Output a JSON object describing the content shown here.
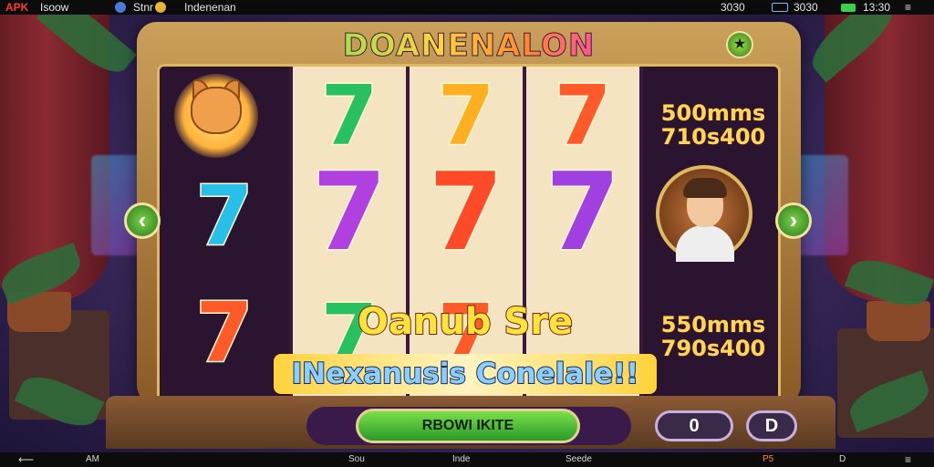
{
  "status_top": {
    "brand": "APK",
    "brand_suffix": "Isoow",
    "tab_a": "Stnr",
    "tab_b": "Indenenan",
    "right_a": "3030",
    "right_b": "3030",
    "right_c": "3030",
    "clock": "13:30"
  },
  "game": {
    "title": "DOANENALON",
    "star_button": "★",
    "reels": [
      {
        "symbols": [
          "dog",
          "7",
          "7"
        ],
        "colors": [
          "",
          "#28c0e8",
          "#ff5a2a"
        ]
      },
      {
        "symbols": [
          "7",
          "7",
          "7"
        ],
        "colors": [
          "#28c060",
          "#b040e0",
          "#28c060"
        ]
      },
      {
        "symbols": [
          "7",
          "7",
          "7"
        ],
        "colors": [
          "#ffb020",
          "#ff4a2a",
          "#ff5a2a"
        ]
      },
      {
        "symbols": [
          "7",
          "7"
        ],
        "colors": [
          "#ff5a2a",
          "#a040e0"
        ]
      }
    ],
    "bonus_top": {
      "line1": "500mms",
      "line2": "710s400"
    },
    "bonus_bottom": {
      "line1": "550mms",
      "line2": "790s400"
    },
    "banner_line1": "Oanub Sre",
    "banner_line2": "INexanusis Conelale!!",
    "nav_left": "‹",
    "nav_right": "›",
    "spin_label": "RBOWI IKITE",
    "btn_zero": "0",
    "btn_d": "D"
  },
  "status_bottom": {
    "a": "AM",
    "b": "Sou",
    "c": "Inde",
    "d": "Seede",
    "e": "P5",
    "f": "D"
  },
  "colors": {
    "accent_gold": "#e0b860",
    "spin_green": "#2a9a2a",
    "panel_purple": "#3a1840"
  }
}
